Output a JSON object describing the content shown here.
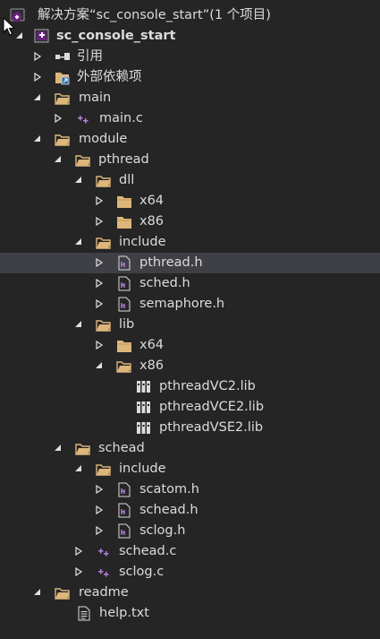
{
  "solution_label": "解决方案“sc_console_start”(1 个项目)",
  "project_label": "sc_console_start",
  "references_label": "引用",
  "external_deps_label": "外部依赖项",
  "folders": {
    "main": "main",
    "module": "module",
    "pthread": "pthread",
    "dll": "dll",
    "dll_x64": "x64",
    "dll_x86": "x86",
    "include": "include",
    "lib": "lib",
    "lib_x64": "x64",
    "lib_x86": "x86",
    "schead": "schead",
    "schead_include": "include",
    "readme": "readme"
  },
  "files": {
    "main_c": "main.c",
    "pthread_h": "pthread.h",
    "sched_h": "sched.h",
    "semaphore_h": "semaphore.h",
    "pthreadVC2_lib": "pthreadVC2.lib",
    "pthreadVCE2_lib": "pthreadVCE2.lib",
    "pthreadVSE2_lib": "pthreadVSE2.lib",
    "scatom_h": "scatom.h",
    "schead_h": "schead.h",
    "sclog_h": "sclog.h",
    "schead_c": "schead.c",
    "sclog_c": "sclog.c",
    "help_txt": "help.txt"
  },
  "selected_item": "pthread.h",
  "colors": {
    "background": "#252526",
    "text": "#dcdcdc",
    "selection": "#3f3f46",
    "folder": "#dcb67a",
    "c_file_badge": "#b180d7",
    "header_file_badge": "#b180d7",
    "solution_accent": "#68217a"
  },
  "icons": {
    "solution": "visual-studio-solution-icon",
    "project": "c-project-icon",
    "references": "references-icon",
    "external_deps": "external-dependencies-icon",
    "folder": "folder-icon",
    "c_file": "c-source-file-icon",
    "header_file": "header-file-icon",
    "lib_file": "library-file-icon",
    "text_file": "text-file-icon"
  }
}
